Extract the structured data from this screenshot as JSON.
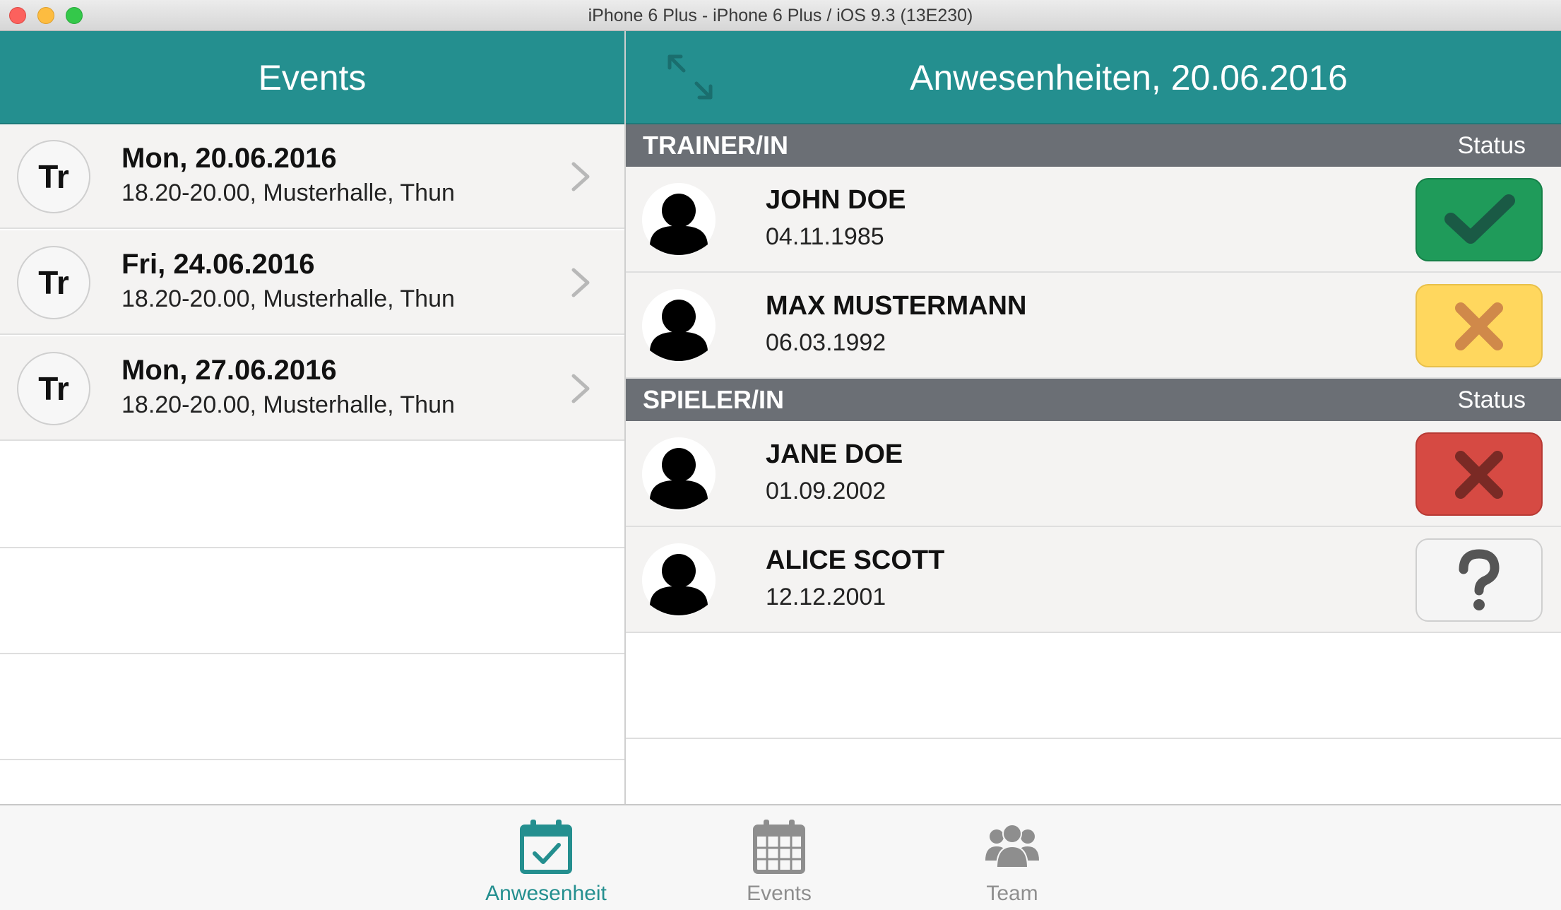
{
  "window": {
    "title": "iPhone 6 Plus - iPhone 6 Plus / iOS 9.3 (13E230)"
  },
  "colors": {
    "accent": "#248f8f",
    "status_present": "#1f9b5a",
    "status_maybe": "#ffd75e",
    "status_absent": "#d64a43",
    "section_header": "#6b6f75"
  },
  "events_pane": {
    "title": "Events",
    "items": [
      {
        "avatar_text": "Tr",
        "date": "Mon, 20.06.2016",
        "location": "18.20-20.00, Musterhalle, Thun"
      },
      {
        "avatar_text": "Tr",
        "date": "Fri, 24.06.2016",
        "location": "18.20-20.00, Musterhalle, Thun"
      },
      {
        "avatar_text": "Tr",
        "date": "Mon, 27.06.2016",
        "location": "18.20-20.00, Musterhalle, Thun"
      }
    ]
  },
  "attendance_pane": {
    "title": "Anwesenheiten, 20.06.2016",
    "expand_icon": "expand-arrows-icon",
    "sections": [
      {
        "title": "TRAINER/IN",
        "status_label": "Status",
        "people": [
          {
            "name": "JOHN DOE",
            "dob": "04.11.1985",
            "status": "present",
            "status_icon": "checkmark-icon"
          },
          {
            "name": "MAX MUSTERMANN",
            "dob": "06.03.1992",
            "status": "maybe",
            "status_icon": "cross-icon"
          }
        ]
      },
      {
        "title": "SPIELER/IN",
        "status_label": "Status",
        "people": [
          {
            "name": "JANE DOE",
            "dob": "01.09.2002",
            "status": "absent",
            "status_icon": "cross-icon"
          },
          {
            "name": "ALICE SCOTT",
            "dob": "12.12.2001",
            "status": "unknown",
            "status_icon": "question-mark-icon"
          }
        ]
      }
    ]
  },
  "tabbar": {
    "tabs": [
      {
        "label": "Anwesenheit",
        "icon": "calendar-check-icon",
        "active": true
      },
      {
        "label": "Events",
        "icon": "calendar-grid-icon",
        "active": false
      },
      {
        "label": "Team",
        "icon": "team-icon",
        "active": false
      }
    ]
  }
}
